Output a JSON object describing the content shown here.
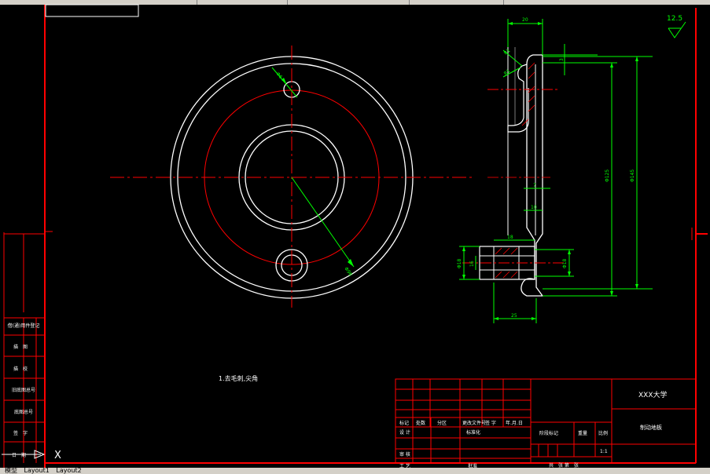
{
  "toolbar": {
    "visible": true
  },
  "layout_tabs": [
    "模型",
    "Layout1",
    "Layout2"
  ],
  "colors": {
    "background": "#000000",
    "outline": "#ffffff",
    "centerline": "#ff0000",
    "dimension": "#00ff00",
    "border": "#ff0000"
  },
  "front_view": {
    "note": "1.去毛刺,尖角"
  },
  "side_view": {
    "dims": {
      "top_width": "20",
      "top_chamfer_a": "R1",
      "top_chamfer_b": "R1",
      "thickness_right": "3",
      "inner_d": "Φ125",
      "outer_d": "Φ145",
      "step": "7",
      "boss_h": "10",
      "boss_w": "18",
      "left_d": "Φ18",
      "left_d2": "16",
      "right_d": "Φ18",
      "bottom_w": "25",
      "hole_d": "Φ6",
      "pcd": "Φ96"
    }
  },
  "roughness": {
    "value": "12.5"
  },
  "left_strip": {
    "labels": [
      "借(通)用件登记",
      "描　图",
      "描　校",
      "旧底图总号",
      "底图总号",
      "签　字",
      "日　期"
    ]
  },
  "title_block": {
    "school": "XXX大学",
    "part_name": "制动地板",
    "headers": [
      "标记",
      "处数",
      "分区",
      "更改文件号",
      "签 字",
      "年.月.日"
    ],
    "design": "设 计",
    "std": "标准化",
    "review": "审 核",
    "process": "工 艺",
    "approve": "批准",
    "stage_mark": "阶段标记",
    "weight": "重量",
    "scale_label": "比例",
    "scale": "1:1",
    "sheets": "共　张  第　张"
  }
}
